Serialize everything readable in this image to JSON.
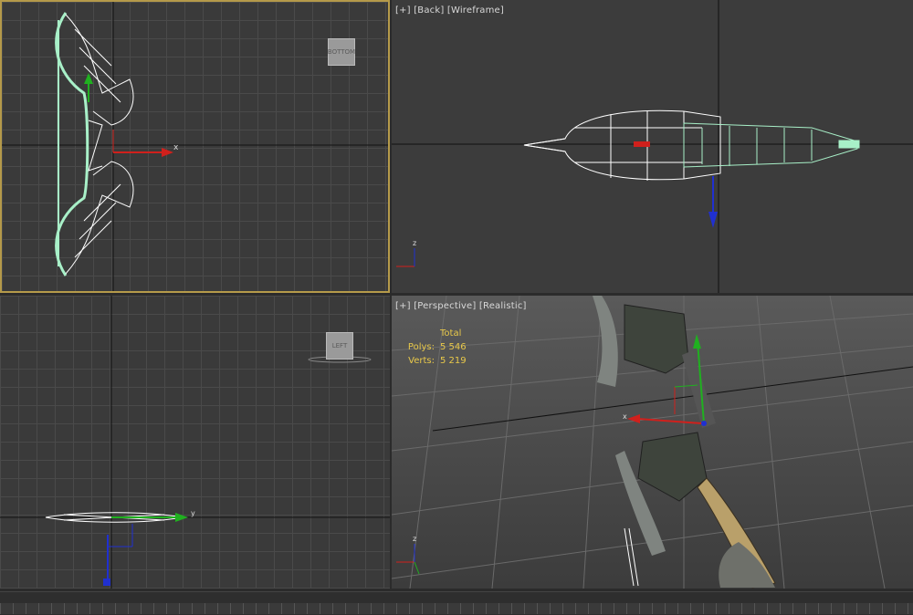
{
  "viewports": {
    "top_left": {
      "label": "",
      "viewcube_label": "BOTTOM",
      "axis_x": "x"
    },
    "top_right": {
      "label_plus": "[+]",
      "label_view": "[Back]",
      "label_shading": "[Wireframe]",
      "axis_z": "z"
    },
    "bottom_left": {
      "viewcube_label": "LEFT",
      "axis_y": "y"
    },
    "bottom_right": {
      "label_plus": "[+]",
      "label_view": "[Perspective]",
      "label_shading": "[Realistic]",
      "stats": {
        "total_label": "Total",
        "polys_label": "Polys:",
        "polys_value": "5 546",
        "verts_label": "Verts:",
        "verts_value": "5 219"
      },
      "axis_x": "x",
      "axis_z": "z"
    }
  },
  "colors": {
    "active_border": "#b59a4a",
    "stats_text": "#e9c94a",
    "axis_x": "#d0201c",
    "axis_y": "#20b020",
    "axis_z": "#2030d0",
    "wire_white": "#ffffff",
    "wire_selected": "#a8f0c8"
  }
}
